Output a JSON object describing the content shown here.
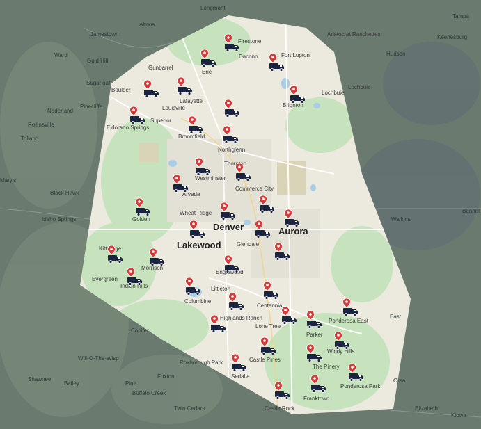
{
  "map": {
    "colors": {
      "outside": "#6b7a6f",
      "inside": "#ece9df",
      "green": "#c6e3bd",
      "water": "#a9cde9",
      "pin": "#d93a3a",
      "truck": "#1a2340"
    },
    "outside_labels": [
      "Longmont",
      "Tampa",
      "Jamestown",
      "Altona",
      "Keenesburg",
      "Ward",
      "Gold Hill",
      "Hudson",
      "Sugarloaf",
      "Nederland",
      "Pinecliffe",
      "Tolland",
      "Rollinsville",
      "Mary's",
      "Black Hawk",
      "Idaho Springs",
      "Walkins",
      "Bennet",
      "East",
      "Conifer",
      "Will-O-The-Wisp",
      "Shawnee",
      "Bailey",
      "Pine",
      "Foxton",
      "Buffalo Creek",
      "Twin Cedars",
      "Elizabeth",
      "Kiowa",
      "Orsa"
    ],
    "inside_labels": [
      "Firestone",
      "Aristocrat Ranchettes",
      "Dacono",
      "Fort Lupton",
      "Gunbarrel",
      "Erie",
      "Boulder",
      "Lochbuie",
      "Lochbuie",
      "Lafayette",
      "Brighton",
      "Louisville",
      "Eldorado Springs",
      "Superior",
      "Broomfield",
      "Northglenn",
      "Thornton",
      "Westminster",
      "Commerce City",
      "Arvada",
      "Wheat Ridge",
      "Golden",
      "Denver",
      "Aurora",
      "Lakewood",
      "Glendale",
      "Kittredge",
      "Morrison",
      "Evergreen",
      "Indian Hills",
      "Englewood",
      "Littleton",
      "Columbine",
      "Centennial",
      "Highlands Ranch",
      "Lone Tree",
      "Parker",
      "Ponderosa East",
      "Windy Hills",
      "Roxborough Park",
      "Castle Pines",
      "The Pinery",
      "Sedalia",
      "Ponderosa Park",
      "Franktown",
      "Castle Rock"
    ],
    "major_labels": [
      "Denver",
      "Lakewood",
      "Aurora"
    ]
  }
}
